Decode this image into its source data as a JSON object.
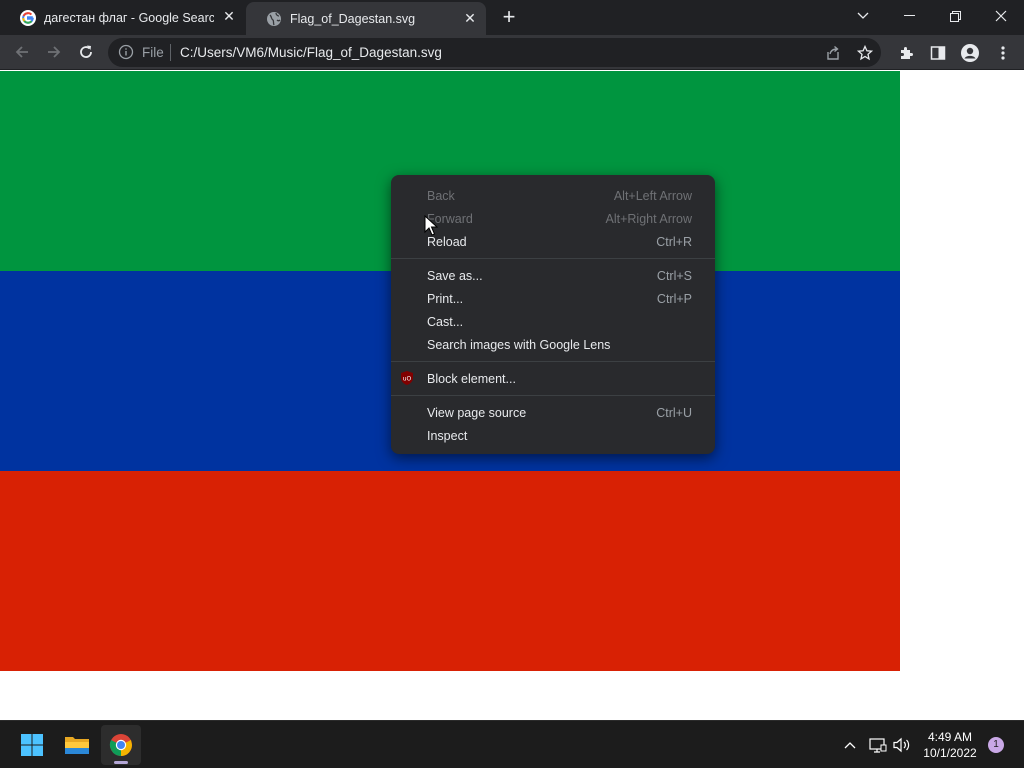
{
  "browser": {
    "tabs": [
      {
        "title": "дагестан флаг - Google Search",
        "favicon": "google-g-icon",
        "active": false
      },
      {
        "title": "Flag_of_Dagestan.svg",
        "favicon": "globe-icon",
        "active": true
      }
    ],
    "new_tab_label": "+",
    "omnibox": {
      "scheme_label": "File",
      "url": "C:/Users/VM6/Music/Flag_of_Dagestan.svg"
    }
  },
  "page": {
    "flag_colors": [
      "#00953f",
      "#0033a0",
      "#d82104"
    ]
  },
  "context_menu": {
    "groups": [
      [
        {
          "label": "Back",
          "shortcut": "Alt+Left Arrow",
          "disabled": true
        },
        {
          "label": "Forward",
          "shortcut": "Alt+Right Arrow",
          "disabled": true
        },
        {
          "label": "Reload",
          "shortcut": "Ctrl+R",
          "disabled": false
        }
      ],
      [
        {
          "label": "Save as...",
          "shortcut": "Ctrl+S"
        },
        {
          "label": "Print...",
          "shortcut": "Ctrl+P"
        },
        {
          "label": "Cast...",
          "shortcut": ""
        },
        {
          "label": "Search images with Google Lens",
          "shortcut": ""
        }
      ],
      [
        {
          "label": "Block element...",
          "shortcut": "",
          "icon": "ublock-origin-icon"
        }
      ],
      [
        {
          "label": "View page source",
          "shortcut": "Ctrl+U"
        },
        {
          "label": "Inspect",
          "shortcut": ""
        }
      ]
    ]
  },
  "taskbar": {
    "apps": [
      "windows-start-icon",
      "file-explorer-icon",
      "chrome-icon"
    ],
    "clock": {
      "time": "4:49 AM",
      "date": "10/1/2022"
    },
    "notification_count": "1"
  }
}
